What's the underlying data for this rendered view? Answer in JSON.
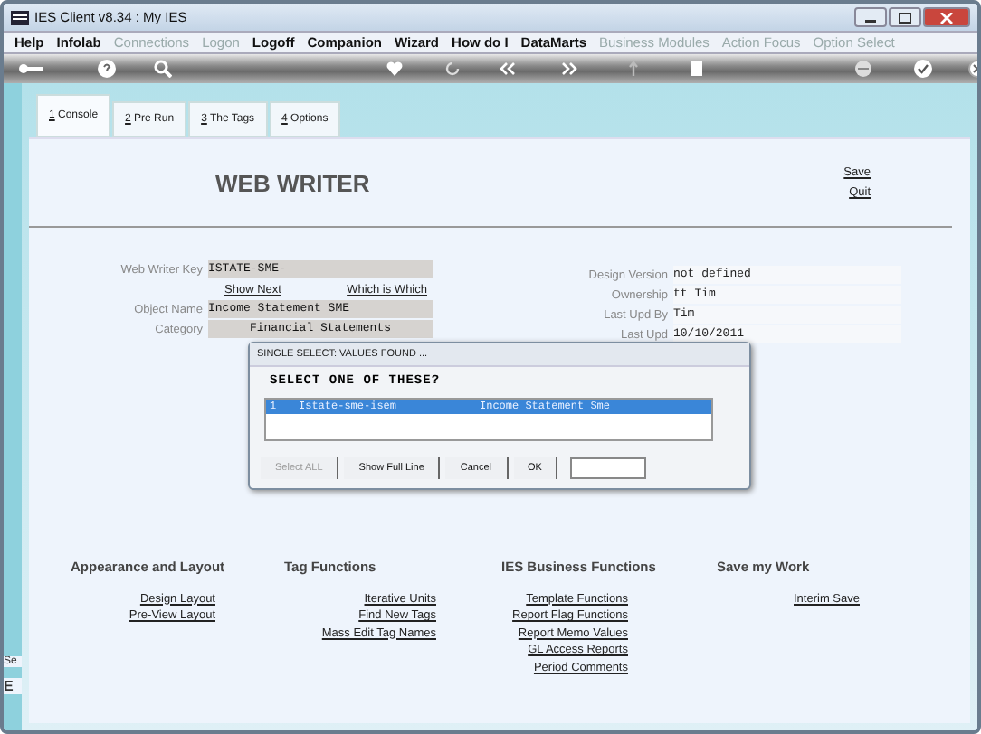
{
  "window": {
    "title": "IES Client v8.34 : My IES"
  },
  "menu": [
    {
      "label": "Help",
      "disabled": false
    },
    {
      "label": "Infolab",
      "disabled": false
    },
    {
      "label": "Connections",
      "disabled": true
    },
    {
      "label": "Logon",
      "disabled": true
    },
    {
      "label": "Logoff",
      "disabled": false
    },
    {
      "label": "Companion",
      "disabled": false
    },
    {
      "label": "Wizard",
      "disabled": false
    },
    {
      "label": "How do I",
      "disabled": false
    },
    {
      "label": "DataMarts",
      "disabled": false
    },
    {
      "label": "Business Modules",
      "disabled": true
    },
    {
      "label": "Action Focus",
      "disabled": true
    },
    {
      "label": "Option Select",
      "disabled": true
    }
  ],
  "tabs": [
    {
      "key": "1",
      "label": " Console",
      "selected": true
    },
    {
      "key": "2",
      "label": " Pre Run",
      "selected": false
    },
    {
      "key": "3",
      "label": " The Tags",
      "selected": false
    },
    {
      "key": "4",
      "label": " Options",
      "selected": false
    }
  ],
  "header": {
    "title": "WEB WRITER",
    "actions": [
      "Save",
      "Quit"
    ]
  },
  "form": {
    "key": {
      "label": "Web Writer Key",
      "value": "ISTATE-SME-"
    },
    "key_links": [
      "Show Next",
      "Which is Which"
    ],
    "fields": [
      {
        "label": "Object Name",
        "value": "Income Statement SME",
        "centered": false
      },
      {
        "label": "Category",
        "value": "Financial Statements",
        "centered": true
      }
    ],
    "right_fields": [
      {
        "label": "Design Version",
        "value": "not defined"
      },
      {
        "label": "Ownership",
        "value": "tt Tim"
      },
      {
        "label": "Last Upd By",
        "value": "Tim"
      },
      {
        "label": "Last Upd",
        "value": "10/10/2011"
      }
    ]
  },
  "dialog": {
    "title": "SINGLE SELECT: VALUES FOUND ...",
    "prompt": "SELECT ONE OF THESE?",
    "rows": [
      {
        "number": "1",
        "code": "Istate-sme-isem",
        "name": "Income Statement Sme",
        "selected": true
      }
    ],
    "buttons": [
      {
        "label": "Select ALL",
        "disabled": true
      },
      {
        "label": "Show Full Line",
        "disabled": false
      },
      {
        "label": "Cancel",
        "disabled": false
      },
      {
        "label": "OK",
        "disabled": false
      }
    ]
  },
  "sections": [
    {
      "heading": "Appearance and Layout",
      "links": [
        "Design Layout",
        "Pre-View Layout"
      ]
    },
    {
      "heading": "Tag Functions",
      "links": [
        "Iterative Units",
        "Find New Tags",
        "Mass Edit Tag Names"
      ]
    },
    {
      "heading": "IES Business Functions",
      "links": [
        "Template Functions",
        "Report Flag Functions",
        "Report Memo Values",
        "GL Access Reports",
        "Period Comments"
      ]
    },
    {
      "heading": "Save my Work",
      "links": [
        "Interim Save"
      ]
    }
  ],
  "side_fragments": [
    "Se",
    "E"
  ]
}
